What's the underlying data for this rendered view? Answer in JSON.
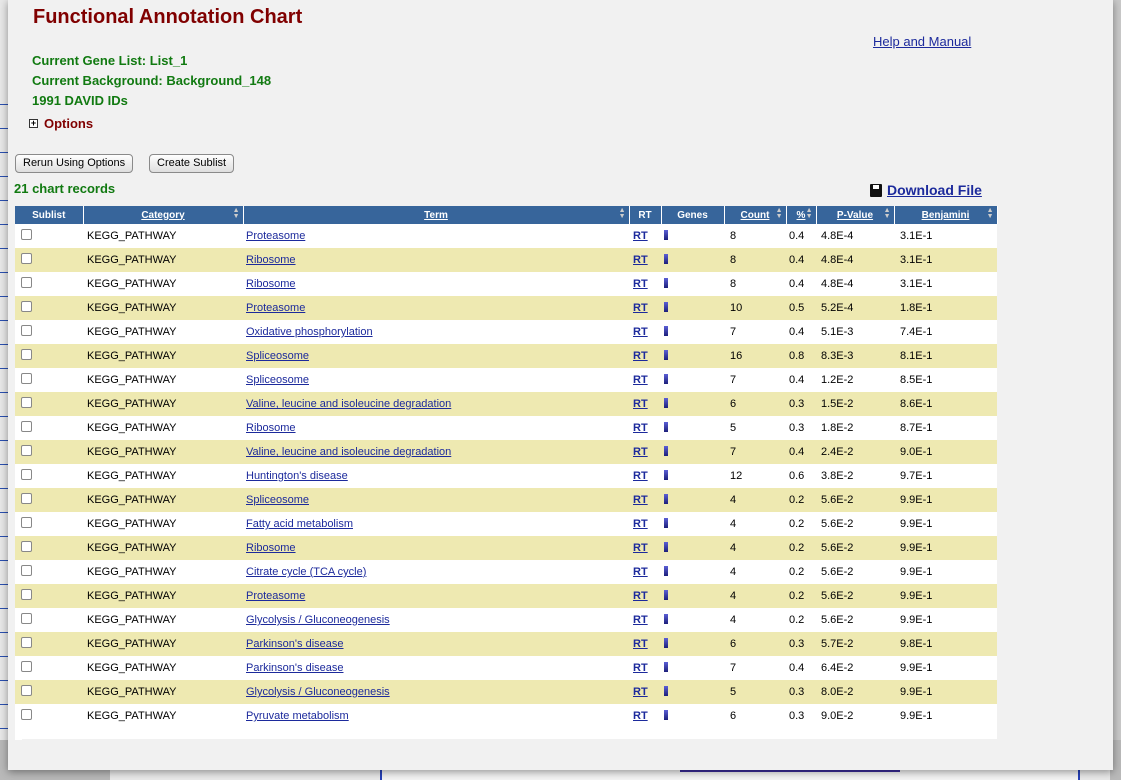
{
  "page": {
    "title": "Functional Annotation Chart",
    "help_link": "Help and Manual",
    "current_gene_list": "Current Gene List: List_1",
    "current_background": "Current Background: Background_148",
    "david_ids": "1991 DAVID IDs",
    "options_label": "Options",
    "options_toggle": "+"
  },
  "buttons": {
    "rerun": "Rerun Using Options",
    "create_sublist": "Create Sublist"
  },
  "records_label": "21 chart records",
  "download_label": "Download File",
  "table": {
    "headers": {
      "sublist": "Sublist",
      "category": "Category",
      "term": "Term",
      "rt": "RT",
      "genes": "Genes",
      "count": "Count",
      "percent": "%",
      "pvalue": "P-Value",
      "benjamini": "Benjamini"
    },
    "rows": [
      {
        "category": "KEGG_PATHWAY",
        "term": "Proteasome",
        "rt": "RT",
        "count": "8",
        "percent": "0.4",
        "pvalue": "4.8E-4",
        "benjamini": "3.1E-1"
      },
      {
        "category": "KEGG_PATHWAY",
        "term": "Ribosome",
        "rt": "RT",
        "count": "8",
        "percent": "0.4",
        "pvalue": "4.8E-4",
        "benjamini": "3.1E-1"
      },
      {
        "category": "KEGG_PATHWAY",
        "term": "Ribosome",
        "rt": "RT",
        "count": "8",
        "percent": "0.4",
        "pvalue": "4.8E-4",
        "benjamini": "3.1E-1"
      },
      {
        "category": "KEGG_PATHWAY",
        "term": "Proteasome",
        "rt": "RT",
        "count": "10",
        "percent": "0.5",
        "pvalue": "5.2E-4",
        "benjamini": "1.8E-1"
      },
      {
        "category": "KEGG_PATHWAY",
        "term": "Oxidative phosphorylation",
        "rt": "RT",
        "count": "7",
        "percent": "0.4",
        "pvalue": "5.1E-3",
        "benjamini": "7.4E-1"
      },
      {
        "category": "KEGG_PATHWAY",
        "term": "Spliceosome",
        "rt": "RT",
        "count": "16",
        "percent": "0.8",
        "pvalue": "8.3E-3",
        "benjamini": "8.1E-1"
      },
      {
        "category": "KEGG_PATHWAY",
        "term": "Spliceosome",
        "rt": "RT",
        "count": "7",
        "percent": "0.4",
        "pvalue": "1.2E-2",
        "benjamini": "8.5E-1"
      },
      {
        "category": "KEGG_PATHWAY",
        "term": "Valine, leucine and isoleucine degradation",
        "rt": "RT",
        "count": "6",
        "percent": "0.3",
        "pvalue": "1.5E-2",
        "benjamini": "8.6E-1"
      },
      {
        "category": "KEGG_PATHWAY",
        "term": "Ribosome",
        "rt": "RT",
        "count": "5",
        "percent": "0.3",
        "pvalue": "1.8E-2",
        "benjamini": "8.7E-1"
      },
      {
        "category": "KEGG_PATHWAY",
        "term": "Valine, leucine and isoleucine degradation",
        "rt": "RT",
        "count": "7",
        "percent": "0.4",
        "pvalue": "2.4E-2",
        "benjamini": "9.0E-1"
      },
      {
        "category": "KEGG_PATHWAY",
        "term": "Huntington's disease",
        "rt": "RT",
        "count": "12",
        "percent": "0.6",
        "pvalue": "3.8E-2",
        "benjamini": "9.7E-1"
      },
      {
        "category": "KEGG_PATHWAY",
        "term": "Spliceosome",
        "rt": "RT",
        "count": "4",
        "percent": "0.2",
        "pvalue": "5.6E-2",
        "benjamini": "9.9E-1"
      },
      {
        "category": "KEGG_PATHWAY",
        "term": "Fatty acid metabolism",
        "rt": "RT",
        "count": "4",
        "percent": "0.2",
        "pvalue": "5.6E-2",
        "benjamini": "9.9E-1"
      },
      {
        "category": "KEGG_PATHWAY",
        "term": "Ribosome",
        "rt": "RT",
        "count": "4",
        "percent": "0.2",
        "pvalue": "5.6E-2",
        "benjamini": "9.9E-1"
      },
      {
        "category": "KEGG_PATHWAY",
        "term": "Citrate cycle (TCA cycle)",
        "rt": "RT",
        "count": "4",
        "percent": "0.2",
        "pvalue": "5.6E-2",
        "benjamini": "9.9E-1"
      },
      {
        "category": "KEGG_PATHWAY",
        "term": "Proteasome",
        "rt": "RT",
        "count": "4",
        "percent": "0.2",
        "pvalue": "5.6E-2",
        "benjamini": "9.9E-1"
      },
      {
        "category": "KEGG_PATHWAY",
        "term": "Glycolysis / Gluconeogenesis",
        "rt": "RT",
        "count": "4",
        "percent": "0.2",
        "pvalue": "5.6E-2",
        "benjamini": "9.9E-1"
      },
      {
        "category": "KEGG_PATHWAY",
        "term": "Parkinson's disease",
        "rt": "RT",
        "count": "6",
        "percent": "0.3",
        "pvalue": "5.7E-2",
        "benjamini": "9.8E-1"
      },
      {
        "category": "KEGG_PATHWAY",
        "term": "Parkinson's disease",
        "rt": "RT",
        "count": "7",
        "percent": "0.4",
        "pvalue": "6.4E-2",
        "benjamini": "9.9E-1"
      },
      {
        "category": "KEGG_PATHWAY",
        "term": "Glycolysis / Gluconeogenesis",
        "rt": "RT",
        "count": "5",
        "percent": "0.3",
        "pvalue": "8.0E-2",
        "benjamini": "9.9E-1"
      },
      {
        "category": "KEGG_PATHWAY",
        "term": "Pyruvate metabolism",
        "rt": "RT",
        "count": "6",
        "percent": "0.3",
        "pvalue": "9.0E-2",
        "benjamini": "9.9E-1"
      }
    ]
  },
  "colors": {
    "title": "#800000",
    "info_green": "#117a11",
    "link_blue": "#1c2a9c",
    "header_blue": "#37659b",
    "row_alt": "#eee9b1"
  },
  "icons": {
    "download": "floppy-disk-icon",
    "genes": "gene-bar-icon",
    "options": "plus-box-icon"
  }
}
